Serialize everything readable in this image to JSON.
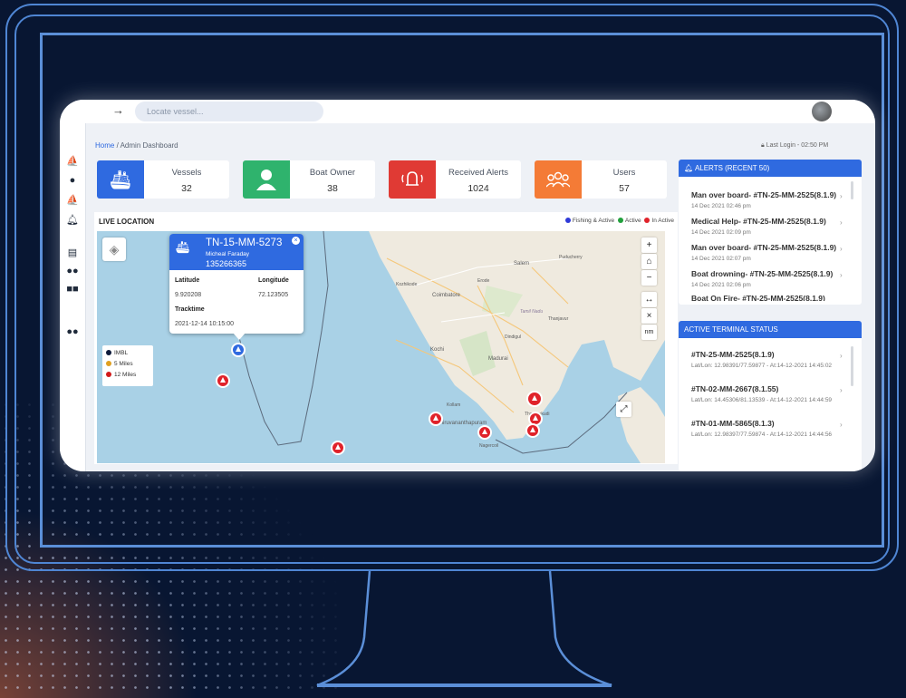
{
  "topbar": {
    "search_placeholder": "Locate vessel..."
  },
  "breadcrumb": {
    "home": "Home",
    "separator": "/",
    "current": "Admin Dashboard"
  },
  "last_login": "Last Login - 02:50 PM",
  "stats": [
    {
      "label": "Vessels",
      "value": "32",
      "color": "#2f6ae0",
      "icon": "ship-icon"
    },
    {
      "label": "Boat Owner",
      "value": "38",
      "color": "#2fb36d",
      "icon": "user-icon"
    },
    {
      "label": "Received Alerts",
      "value": "1024",
      "color": "#e03a34",
      "icon": "bell-icon"
    },
    {
      "label": "Users",
      "value": "57",
      "color": "#f47b36",
      "icon": "users-icon"
    }
  ],
  "live_location": {
    "title": "LIVE LOCATION",
    "legend": [
      {
        "label": "Fishing & Active",
        "color": "#2f3ad8"
      },
      {
        "label": "Active",
        "color": "#21a03c"
      },
      {
        "label": "In Active",
        "color": "#e0222a"
      }
    ],
    "map_legend": [
      {
        "label": "IMBL",
        "color": "#0d1a3a"
      },
      {
        "label": "5 Miles",
        "color": "#e0a020"
      },
      {
        "label": "12 Miles",
        "color": "#d11a1a"
      }
    ],
    "controls": {
      "zoom_in": "+",
      "home": "⌂",
      "zoom_out": "−",
      "measure": "↔",
      "clear": "×",
      "unit": "nm",
      "fullscreen": "⤢"
    },
    "popup": {
      "vessel_id": "TN-15-MM-5273",
      "owner": "Micheal Faraday",
      "number": "135266365",
      "latitude_label": "Latitude",
      "longitude_label": "Longitude",
      "latitude": "9.920208",
      "longitude": "72.123505",
      "tracktime_label": "Tracktime",
      "tracktime": "2021-12-14 10:15:00"
    },
    "place_labels": [
      "Salem",
      "Puducherry",
      "Erode",
      "Coimbatore",
      "Kozhikode",
      "Tamil Nadu",
      "Thanjavur",
      "Dindigul",
      "Kochi",
      "Madurai",
      "Kollam",
      "Thiruvananthapuram",
      "Nagercoil",
      "Thoothukudi"
    ]
  },
  "alerts": {
    "title": "ALERTS (RECENT 50)",
    "items": [
      {
        "title": "Man over board- #TN-25-MM-2525(8.1.9)",
        "time": "14 Dec 2021 02:46 pm"
      },
      {
        "title": "Medical Help- #TN-25-MM-2525(8.1.9)",
        "time": "14 Dec 2021 02:09 pm"
      },
      {
        "title": "Man over board- #TN-25-MM-2525(8.1.9)",
        "time": "14 Dec 2021 02:07 pm"
      },
      {
        "title": "Boat drowning- #TN-25-MM-2525(8.1.9)",
        "time": "14 Dec 2021 02:06 pm"
      },
      {
        "title": "Boat On Fire- #TN-25-MM-2525(8.1.9)",
        "time": ""
      }
    ]
  },
  "terminal_status": {
    "title": "ACTIVE TERMINAL STATUS",
    "items": [
      {
        "title": "#TN-25-MM-2525(8.1.9)",
        "detail": "Lat/Lon: 12.98391/77.59877 - At:14-12-2021 14:45:02"
      },
      {
        "title": "#TN-02-MM-2667(8.1.55)",
        "detail": "Lat/Lon: 14.45306/81.13539 - At:14-12-2021 14:44:59"
      },
      {
        "title": "#TN-01-MM-5865(8.1.3)",
        "detail": "Lat/Lon: 12.98397/77.59874 - At:14-12-2021 14:44:56"
      }
    ]
  }
}
